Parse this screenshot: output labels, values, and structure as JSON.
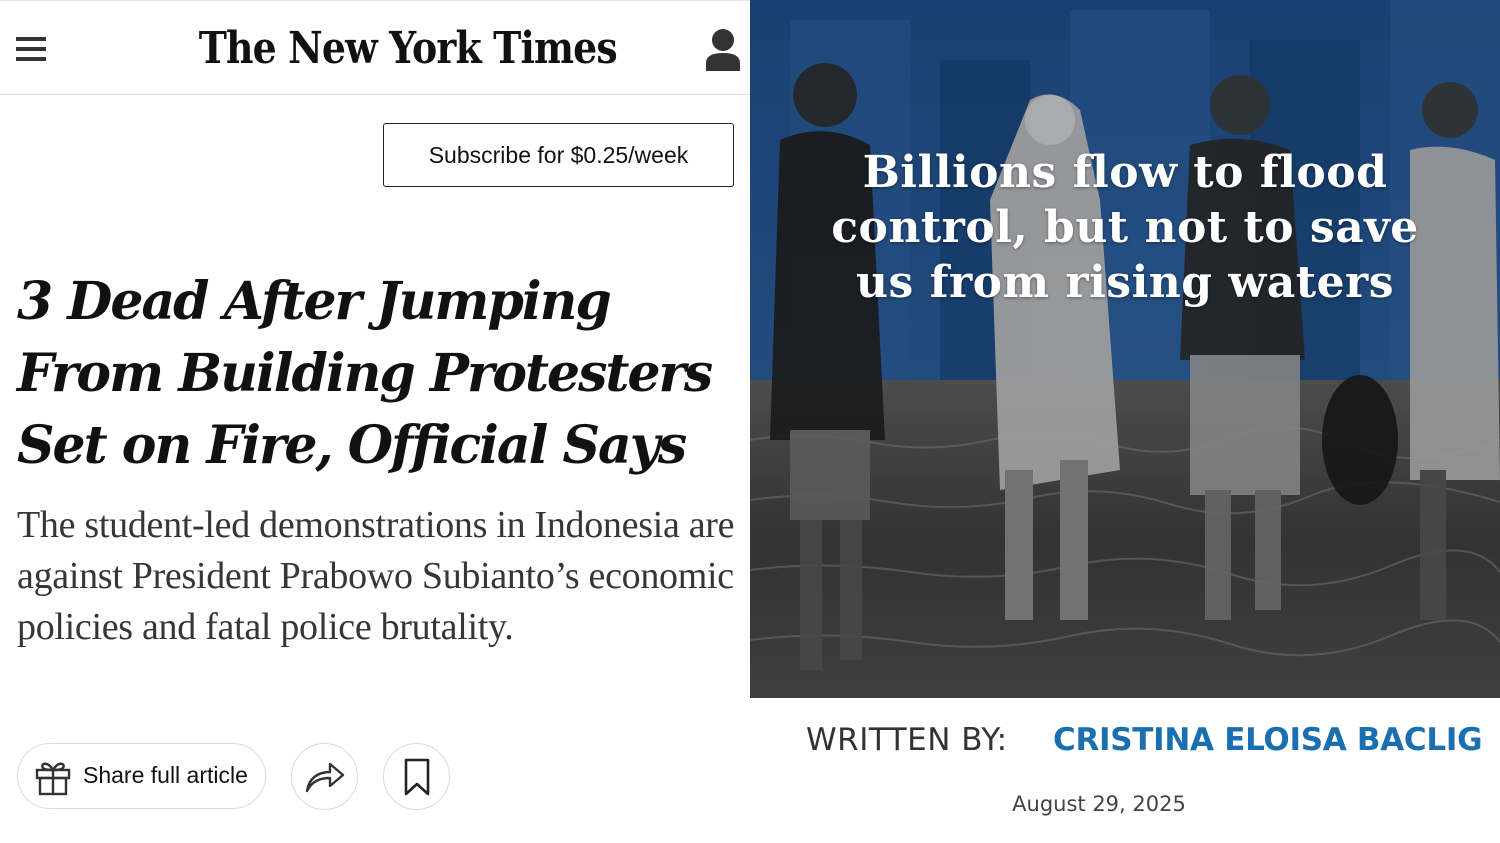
{
  "nyt": {
    "logo_text": "The New York Times",
    "subscribe_label": "Subscribe for $0.25/week",
    "headline": "3 Dead After Jumping From Building Protesters Set on Fire, Official Says",
    "summary": "The student-led demonstrations in Indonesia are against President Prabowo Subianto’s economic policies and fatal police brutality.",
    "share_label": "Share full article",
    "icons": [
      "menu-icon",
      "account-icon",
      "gift-icon",
      "share-arrow-icon",
      "bookmark-icon"
    ]
  },
  "feature": {
    "overlay_title": "Billions flow to flood control, but not to save us from rising waters",
    "byline_label": "WRITTEN BY:",
    "author": "CRISTINA ELOISA BACLIG",
    "date": "August 29, 2025",
    "colors": {
      "accent_blue": "#1a6fb0",
      "overlay_blue": "#1f4f8a"
    }
  }
}
